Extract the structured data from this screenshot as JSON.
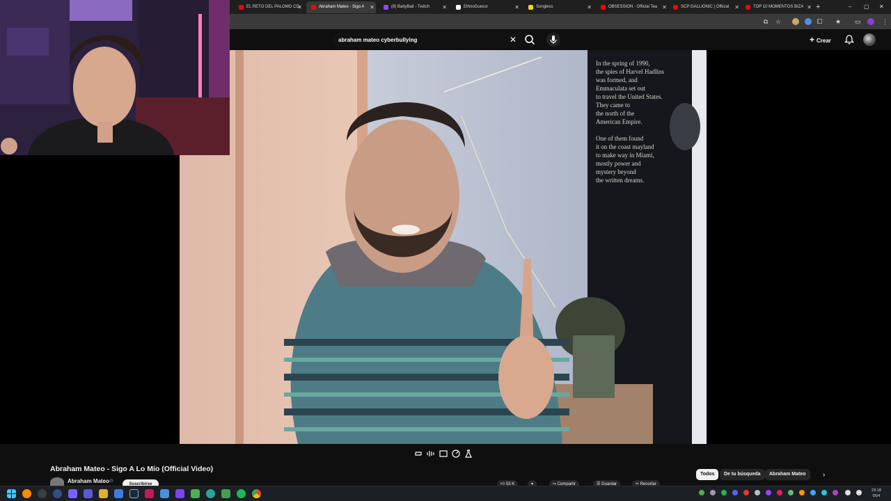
{
  "browser": {
    "tabs": [
      {
        "title": "EL RETO DEL PALOMO CO",
        "favicon_color": "#ff0000",
        "active": false
      },
      {
        "title": "Abraham Mateo - Sigo A",
        "favicon_color": "#ff0000",
        "active": true
      },
      {
        "title": "(8) BaityBait - Twitch",
        "favicon_color": "#9146ff",
        "active": false
      },
      {
        "title": "EthnoGuessr",
        "favicon_color": "#ffffff",
        "active": false
      },
      {
        "title": "Songless",
        "favicon_color": "#f5d90a",
        "active": false
      },
      {
        "title": "OBSESSION - Official Tea",
        "favicon_color": "#ff0000",
        "active": false
      },
      {
        "title": "SCP:GALLIONIC | Official",
        "favicon_color": "#ff0000",
        "active": false
      },
      {
        "title": "TOP 10 MOMENTOS BIZA",
        "favicon_color": "#ff0000",
        "active": false
      }
    ],
    "new_tab": "+",
    "window_controls": {
      "minimize": "–",
      "maximize": "▢",
      "close": "✕"
    }
  },
  "youtube": {
    "search": {
      "query": "abraham mateo cyberbullying",
      "clear": "✕"
    },
    "create_label": "Crear",
    "video": {
      "title": "Abraham Mateo - Sigo A Lo Mío (Official Video)",
      "channel": "Abraham Mateo",
      "verified": "⊙",
      "subscribe_label": "Suscribirse",
      "actions": [
        "53 K",
        "",
        "Compartir",
        "Guardar",
        "Recortar"
      ]
    },
    "chips": [
      "Todos",
      "De tu búsqueda",
      "Abraham Mateo"
    ],
    "chip_next": "›",
    "poster_text": "In the spring of 1990, the spies of Harvel Hadlins was formed, and Emmaculata set out to travel the United States. They came to the north of the American Empire. One of them found it on the coast mayland to make way in Miami, mostly power and mystery beyond the written dreams."
  },
  "taskbar": {
    "time": "23:18",
    "date": "06/4"
  },
  "colors": {
    "youtube_red": "#ff0000",
    "bg": "#0f0f0f",
    "chip_active": "#f1f1f1"
  }
}
